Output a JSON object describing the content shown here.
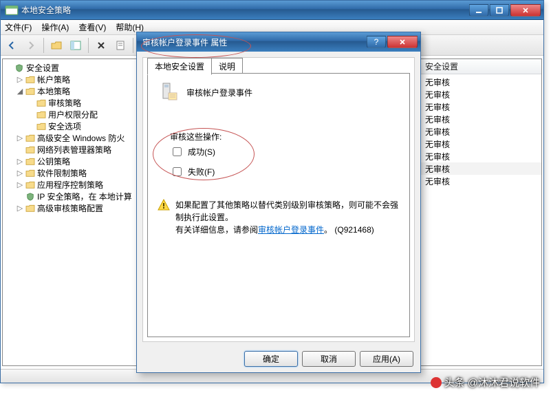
{
  "window": {
    "title": "本地安全策略"
  },
  "menu": {
    "file": "文件(F)",
    "action": "操作(A)",
    "view": "查看(V)",
    "help": "帮助(H)"
  },
  "tree": {
    "root": "安全设置",
    "items": [
      {
        "label": "帐户策略",
        "indent": 1,
        "expander": "▷"
      },
      {
        "label": "本地策略",
        "indent": 1,
        "expander": "◢"
      },
      {
        "label": "审核策略",
        "indent": 2,
        "expander": ""
      },
      {
        "label": "用户权限分配",
        "indent": 2,
        "expander": ""
      },
      {
        "label": "安全选项",
        "indent": 2,
        "expander": ""
      },
      {
        "label": "高级安全 Windows 防火",
        "indent": 1,
        "expander": "▷"
      },
      {
        "label": "网络列表管理器策略",
        "indent": 1,
        "expander": ""
      },
      {
        "label": "公钥策略",
        "indent": 1,
        "expander": "▷"
      },
      {
        "label": "软件限制策略",
        "indent": 1,
        "expander": "▷"
      },
      {
        "label": "应用程序控制策略",
        "indent": 1,
        "expander": "▷"
      },
      {
        "label": "IP 安全策略，在 本地计算",
        "indent": 1,
        "expander": "",
        "special": true
      },
      {
        "label": "高级审核策略配置",
        "indent": 1,
        "expander": "▷"
      }
    ]
  },
  "list": {
    "header": "安全设置",
    "rows": [
      "无审核",
      "无审核",
      "无审核",
      "无审核",
      "无审核",
      "无审核",
      "无审核",
      "无审核",
      "无审核"
    ]
  },
  "dialog": {
    "title": "审核帐户登录事件 属性",
    "tab_local": "本地安全设置",
    "tab_explain": "说明",
    "event_title": "审核帐户登录事件",
    "audit_label": "审核这些操作:",
    "success": "成功(S)",
    "failure": "失败(F)",
    "info_l1": "如果配置了其他策略以替代类别级别审核策略，则可能不会强制执行此设置。",
    "info_l2a": "有关详细信息，请参阅",
    "info_link": "审核帐户登录事件",
    "info_l2b": "。  (Q921468)",
    "ok": "确定",
    "cancel": "取消",
    "apply": "应用(A)"
  },
  "watermark": "头条 @沐沐君说软件"
}
